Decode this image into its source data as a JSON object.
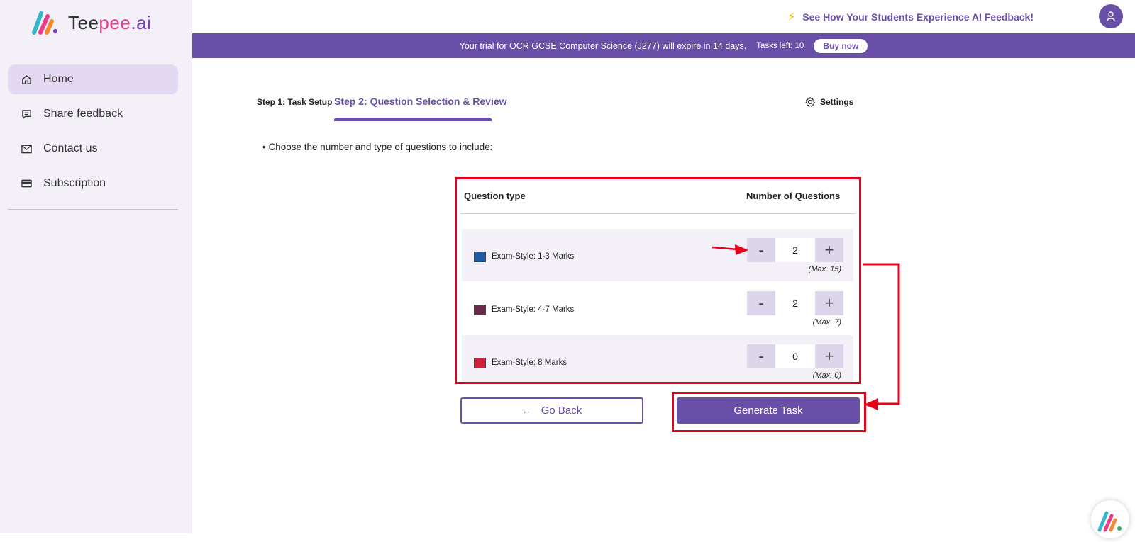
{
  "app": {
    "logo_text_a": "Tee",
    "logo_text_b": "pee",
    "logo_text_c": ".ai"
  },
  "sidebar": {
    "items": [
      {
        "label": "Home",
        "icon": "home-icon",
        "active": true
      },
      {
        "label": "Share feedback",
        "icon": "feedback-icon",
        "active": false
      },
      {
        "label": "Contact us",
        "icon": "mail-icon",
        "active": false
      },
      {
        "label": "Subscription",
        "icon": "card-icon",
        "active": false
      }
    ]
  },
  "header": {
    "promo": "See How Your Students Experience AI Feedback!",
    "avatar_icon": "user-icon"
  },
  "banner": {
    "message": "Your trial for OCR GCSE Computer Science (J277) will expire in 14 days.",
    "tasks_left": "Tasks left: 10",
    "buy_label": "Buy now"
  },
  "steps": {
    "step1": "Step 1: Task Setup",
    "step2": "Step 2: Question Selection & Review",
    "settings": "Settings"
  },
  "instruction": "• Choose the number and type of questions to include:",
  "table": {
    "col_type": "Question type",
    "col_count": "Number of Questions",
    "rows": [
      {
        "label": "Exam-Style: 1-3 Marks",
        "value": "2",
        "max": "(Max. 15)",
        "color": "#1f5aa6"
      },
      {
        "label": "Exam-Style: 4-7 Marks",
        "value": "2",
        "max": "(Max. 7)",
        "color": "#6b2a4a"
      },
      {
        "label": "Exam-Style: 8 Marks",
        "value": "0",
        "max": "(Max. 0)",
        "color": "#d21f3c"
      }
    ],
    "minus": "-",
    "plus": "+"
  },
  "actions": {
    "go_back": "Go Back",
    "generate": "Generate Task"
  },
  "colors": {
    "accent": "#6a4fa8",
    "annotation": "#e3001b"
  }
}
